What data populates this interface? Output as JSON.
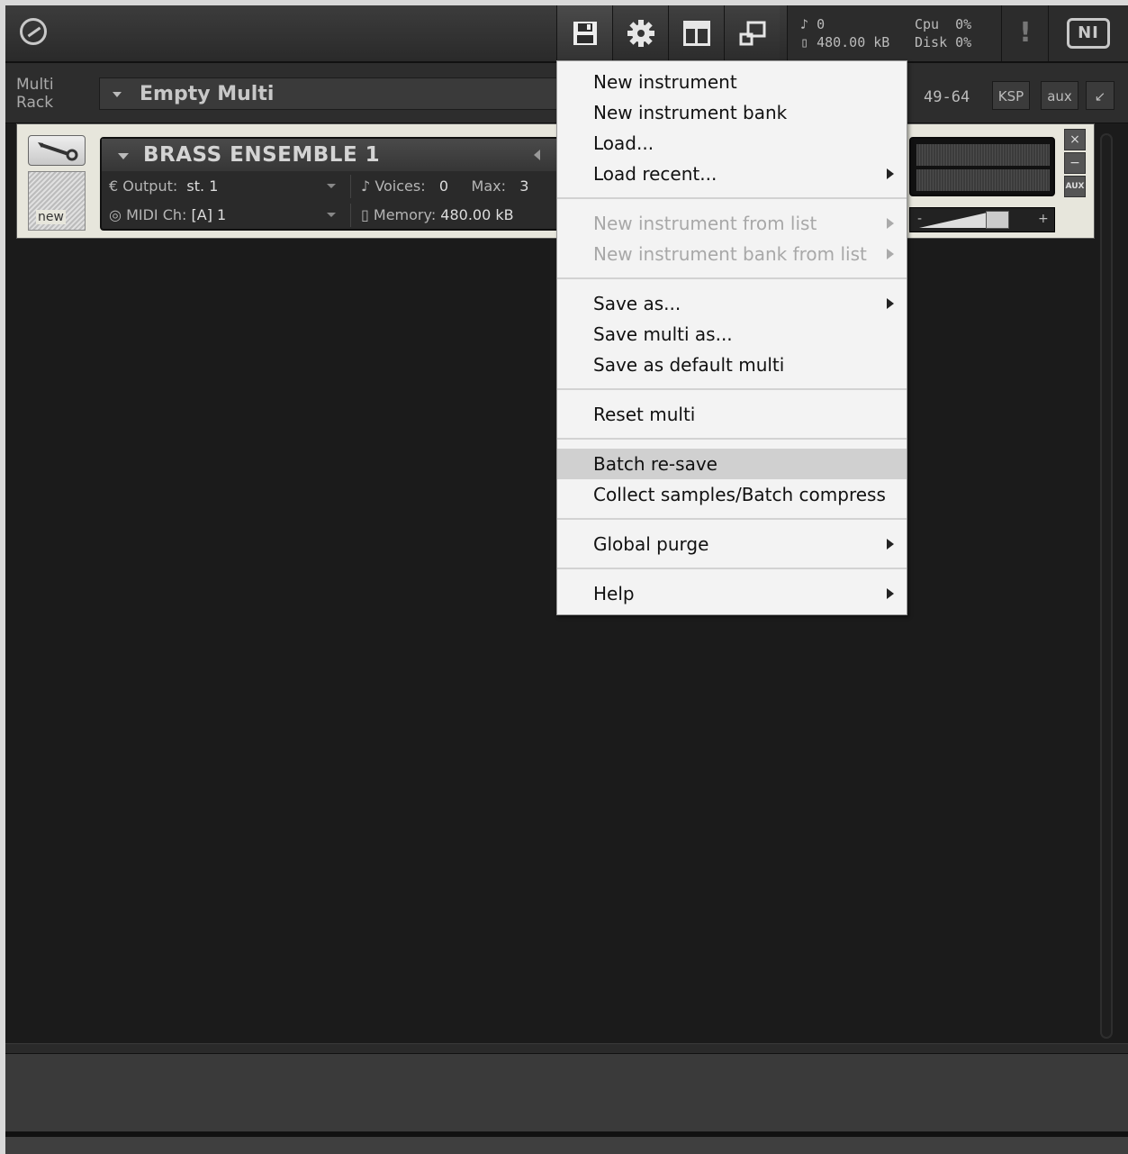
{
  "toolbar": {
    "status_voices": "0",
    "status_memory": "480.00 kB",
    "cpu_label": "Cpu",
    "cpu_value": "0%",
    "disk_label": "Disk",
    "disk_value": "0%",
    "warning": "!",
    "ni_logo": "NI"
  },
  "rack": {
    "label_line1": "Multi",
    "label_line2": "Rack",
    "multi_name": "Empty Multi",
    "range": "49-64",
    "ksp": "KSP",
    "aux": "aux"
  },
  "instrument": {
    "new_label": "new",
    "name": "BRASS ENSEMBLE 1",
    "output_label": "Output:",
    "output_value": "st. 1",
    "voices_label": "Voices:",
    "voices_value": "0",
    "max_label": "Max:",
    "max_value": "3",
    "midi_label": "MIDI Ch:",
    "midi_value": "[A]  1",
    "memory_label": "Memory:",
    "memory_value": "480.00 kB",
    "fader_minus": "-",
    "fader_plus": "+",
    "aux_btn": "AUX",
    "close": "×",
    "minimize": "−"
  },
  "menu": {
    "items": [
      {
        "label": "New instrument",
        "submenu": false,
        "disabled": false
      },
      {
        "label": "New instrument bank",
        "submenu": false,
        "disabled": false
      },
      {
        "label": "Load...",
        "submenu": false,
        "disabled": false
      },
      {
        "label": "Load recent...",
        "submenu": true,
        "disabled": false
      },
      {
        "label": "New instrument from list",
        "submenu": true,
        "disabled": true
      },
      {
        "label": "New instrument bank from list",
        "submenu": true,
        "disabled": true
      },
      {
        "label": "Save as...",
        "submenu": true,
        "disabled": false
      },
      {
        "label": "Save multi as...",
        "submenu": false,
        "disabled": false
      },
      {
        "label": "Save as default multi",
        "submenu": false,
        "disabled": false
      },
      {
        "label": "Reset multi",
        "submenu": false,
        "disabled": false
      },
      {
        "label": "Batch re-save",
        "submenu": false,
        "disabled": false,
        "highlighted": true
      },
      {
        "label": "Collect samples/Batch compress",
        "submenu": false,
        "disabled": false
      },
      {
        "label": "Global purge",
        "submenu": true,
        "disabled": false
      },
      {
        "label": "Help",
        "submenu": true,
        "disabled": false
      }
    ]
  }
}
